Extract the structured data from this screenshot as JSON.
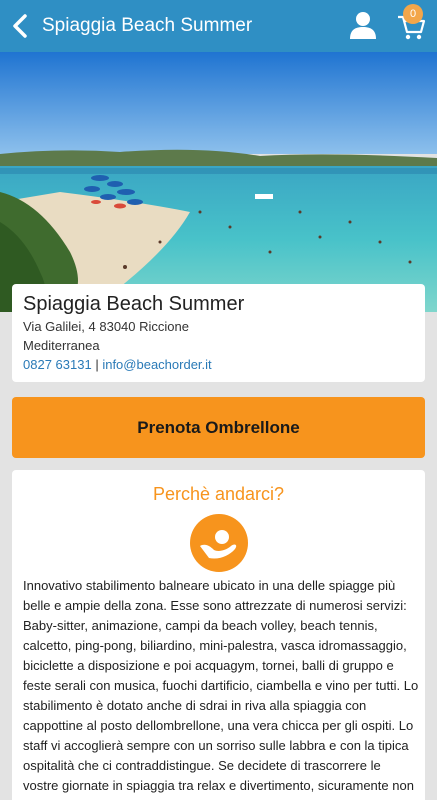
{
  "header": {
    "title": "Spiaggia Beach Summer",
    "cart_count": "0",
    "back_icon": "chevron-left-icon",
    "user_icon": "user-icon",
    "cart_icon": "cart-icon",
    "bar_color": "#2f8fc4"
  },
  "info": {
    "name": "Spiaggia Beach Summer",
    "address": "Via Galilei, 4 83040 Riccione",
    "region": "Mediterranea",
    "phone": "0827 63131",
    "separator": "|",
    "email": "info@beachorder.it"
  },
  "actions": {
    "book_label": "Prenota Ombrellone",
    "accent_color": "#f7941d"
  },
  "why": {
    "title": "Perchè andarci?",
    "icon": "hand-sun-icon",
    "description": "Innovativo stabilimento balneare ubicato in una delle spiagge più belle e ampie della zona. Esse sono attrezzate di numerosi servizi:  Baby-sitter, animazione, campi da beach volley, beach tennis, calcetto, ping-pong, biliardino, mini-palestra, vasca idromassaggio, biciclette a disposizione e poi acquagym, tornei, balli di gruppo e feste serali con musica, fuochi dartificio, ciambella e vino per tutti. Lo stabilimento è dotato anche di sdrai in riva alla spiaggia con cappottine al posto dellombrellone, una vera chicca per gli ospiti. Lo staff vi accoglierà sempre con un sorriso sulle labbra e con la tipica ospitalità che ci contraddistingue. Se decidete di trascorrere le vostre giornate in spiaggia tra relax e divertimento, sicuramente non ve ne pentirete."
  }
}
